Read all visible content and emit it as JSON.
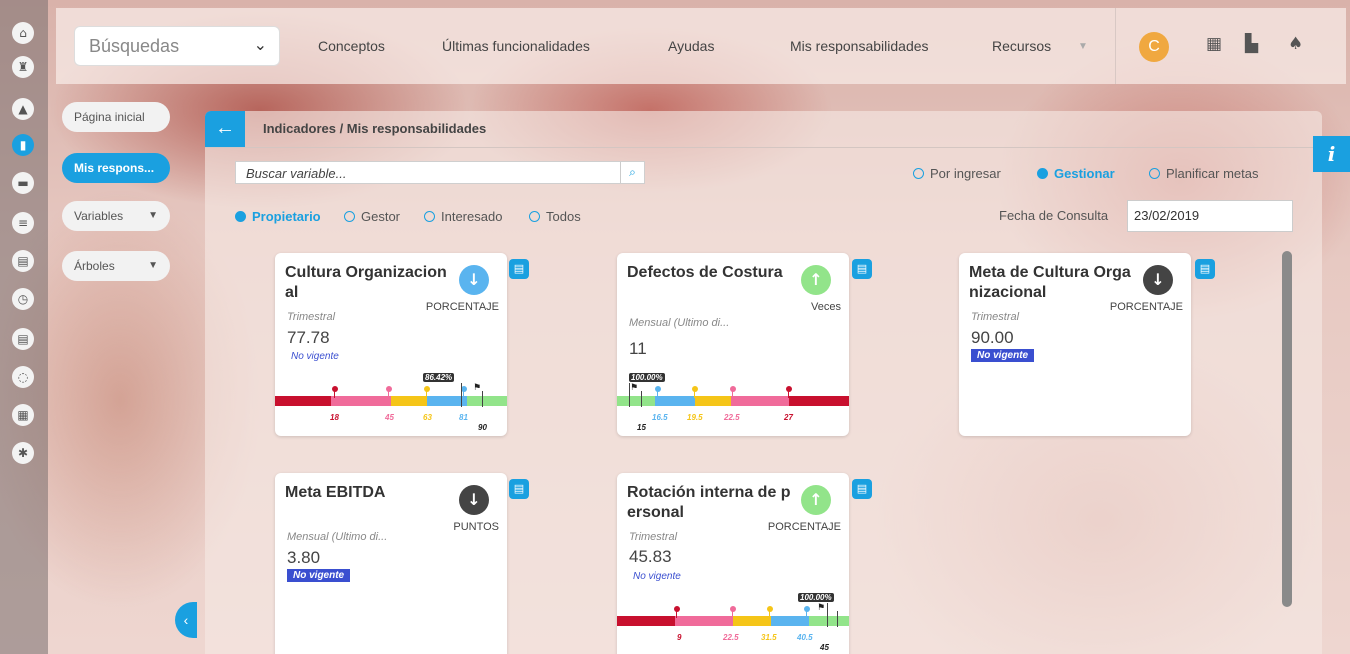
{
  "topbar": {
    "search_label": "Búsquedas",
    "nav": [
      "Conceptos",
      "Últimas funcionalidades",
      "Ayudas",
      "Mis responsabilidades",
      "Recursos"
    ],
    "avatar_initial": "C"
  },
  "side_menu": {
    "home": "Página inicial",
    "mine": "Mis respons...",
    "variables": "Variables",
    "trees": "Árboles"
  },
  "panel": {
    "breadcrumb": "Indicadores / Mis responsabilidades",
    "search_placeholder": "Buscar variable...",
    "modes": [
      "Por ingresar",
      "Gestionar",
      "Planificar metas"
    ],
    "active_mode": "Gestionar",
    "roles": [
      "Propietario",
      "Gestor",
      "Interesado",
      "Todos"
    ],
    "active_role": "Propietario",
    "date_label": "Fecha de Consulta",
    "date_value": "23/02/2019"
  },
  "cards": [
    {
      "title": "Cultura Organizacional",
      "unit": "PORCENTAJE",
      "frequency": "Trimestral",
      "value": "77.78",
      "status": "No vigente",
      "trend": "down",
      "trend_color": "#5ab4ef",
      "flag_pct": "86.42%",
      "thresholds": [
        "18",
        "45",
        "63",
        "81",
        "90"
      ]
    },
    {
      "title": "Defectos de Costura",
      "unit": "Veces",
      "frequency": "Mensual (Ultimo di...",
      "value": "11",
      "trend": "up",
      "trend_color": "#92e48a",
      "flag_pct": "100.00%",
      "thresholds": [
        "15",
        "16.5",
        "19.5",
        "22.5",
        "27"
      ]
    },
    {
      "title": "Meta de Cultura Organizacional",
      "unit": "PORCENTAJE",
      "frequency": "Trimestral",
      "value": "90.00",
      "status": "No vigente",
      "trend": "down",
      "trend_color": "#444444"
    },
    {
      "title": "Meta EBITDA",
      "unit": "PUNTOS",
      "frequency": "Mensual (Ultimo di...",
      "value": "3.80",
      "status": "No vigente",
      "trend": "down",
      "trend_color": "#444444"
    },
    {
      "title": "Rotación interna de personal",
      "unit": "PORCENTAJE",
      "frequency": "Trimestral",
      "value": "45.83",
      "status": "No vigente",
      "trend": "up",
      "trend_color": "#92e48a",
      "flag_pct": "100.00%",
      "thresholds": [
        "9",
        "22.5",
        "31.5",
        "40.5",
        "45"
      ]
    }
  ],
  "colors": {
    "accent": "#1aa0e0",
    "band_red": "#c8102e",
    "band_pink": "#f06b9a",
    "band_yellow": "#f5c518",
    "band_blue": "#5ab4ef",
    "band_green": "#92e48a",
    "badge_blue": "#3a4fd0"
  },
  "icons": [
    "home-icon",
    "rook-icon",
    "triangle-icon",
    "bar-chart-icon",
    "presentation-icon",
    "align-icon",
    "map-icon",
    "clock-icon",
    "document-icon",
    "cycle-icon",
    "calendar-icon",
    "gear-icon",
    "calendar-grid-icon",
    "map-book-icon",
    "bell-icon",
    "search-icon",
    "comment-icon",
    "checkered-flag-icon",
    "arrow-left-icon",
    "chevron-left-icon",
    "info-icon"
  ]
}
